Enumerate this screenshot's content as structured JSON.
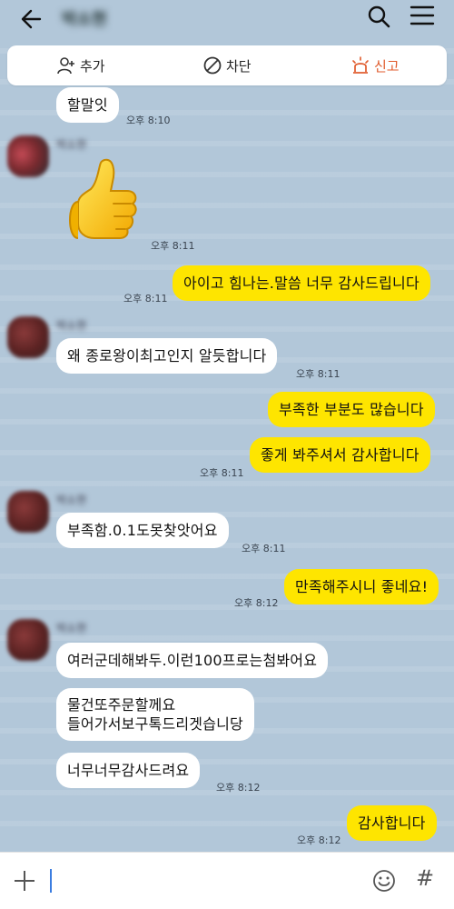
{
  "header": {
    "title": "박소현",
    "back_icon": "back-arrow-icon",
    "search_icon": "search-icon",
    "menu_icon": "menu-icon"
  },
  "actions": {
    "add_label": "추가",
    "block_label": "차단",
    "report_label": "신고",
    "report_color": "#e05a2b"
  },
  "colors": {
    "background": "#b2c7d9",
    "incoming_bubble": "#ffffff",
    "outgoing_bubble": "#fee500"
  },
  "messages": [
    {
      "direction": "in",
      "text": "할말잇",
      "time": "오후 8:10"
    },
    {
      "direction": "in",
      "sender": "박소현",
      "type": "emoticon",
      "emoticon": "thumbs-up-icon",
      "time": "오후 8:11"
    },
    {
      "direction": "out",
      "text": "아이고 힘나는.말씀 너무 감사드립니다",
      "time": "오후 8:11"
    },
    {
      "direction": "in",
      "sender": "박소현",
      "text": "왜 종로왕이최고인지 알듯합니다",
      "time": "오후 8:11"
    },
    {
      "direction": "out",
      "text": "부족한 부분도 많습니다",
      "time": ""
    },
    {
      "direction": "out",
      "text": "좋게 봐주셔서 감사합니다",
      "time": "오후 8:11"
    },
    {
      "direction": "in",
      "sender": "박소현",
      "text": "부족함.0.1도못찾앗어요",
      "time": "오후 8:11"
    },
    {
      "direction": "out",
      "text": "만족해주시니 좋네요!",
      "time": "오후 8:12"
    },
    {
      "direction": "in",
      "sender": "박소현",
      "text": "여러군데해봐두.이런100프로는첨봐어요",
      "time": ""
    },
    {
      "direction": "in",
      "text_line1": "물건또주문할께요",
      "text_line2": "들어가서보구톡드리겟습니당",
      "time": ""
    },
    {
      "direction": "in",
      "text": "너무너무감사드려요",
      "time": "오후 8:12"
    },
    {
      "direction": "out",
      "text": "감사합니다",
      "time": "오후 8:12"
    }
  ],
  "input": {
    "plus_icon": "plus-icon",
    "emoji_icon": "emoji-icon",
    "hash_icon": "hash-icon",
    "hash_symbol": "#",
    "value": ""
  }
}
